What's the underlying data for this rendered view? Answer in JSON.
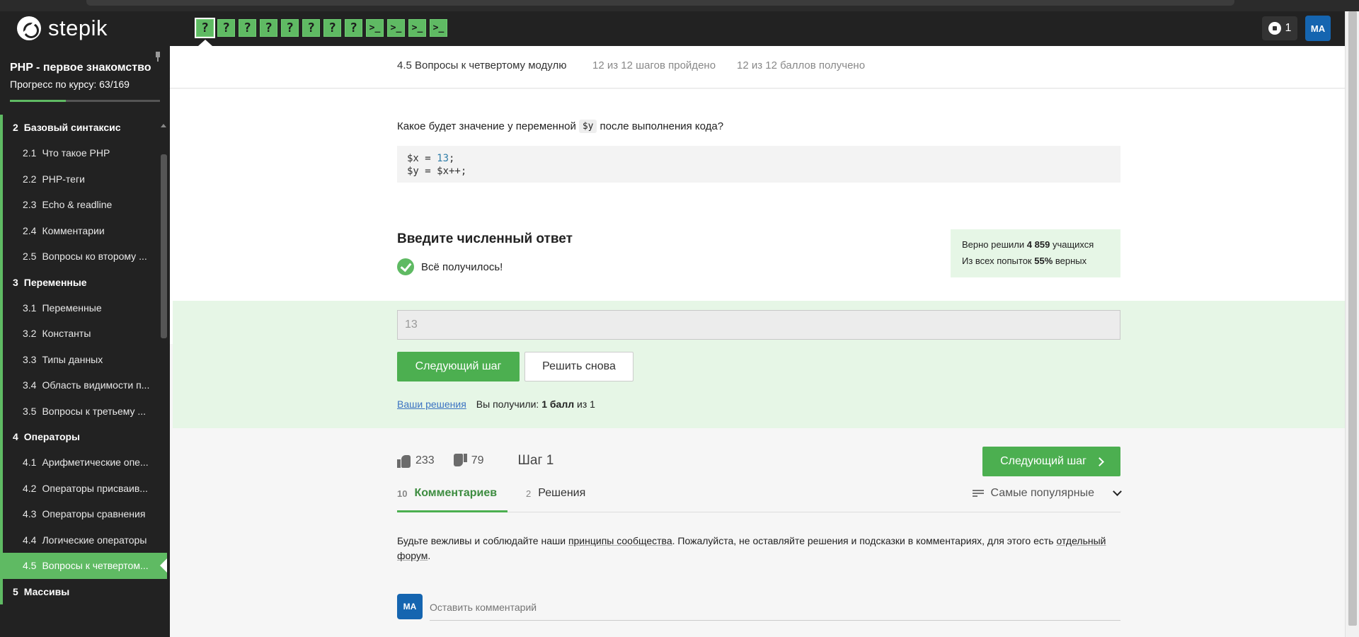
{
  "app": {
    "logo_text": "stepik"
  },
  "topbar": {
    "steps": [
      {
        "label": "?",
        "type": "quiz",
        "active": true
      },
      {
        "label": "?",
        "type": "quiz"
      },
      {
        "label": "?",
        "type": "quiz"
      },
      {
        "label": "?",
        "type": "quiz"
      },
      {
        "label": "?",
        "type": "quiz"
      },
      {
        "label": "?",
        "type": "quiz"
      },
      {
        "label": "?",
        "type": "quiz"
      },
      {
        "label": "?",
        "type": "quiz"
      },
      {
        "label": ">_",
        "type": "code"
      },
      {
        "label": ">_",
        "type": "code"
      },
      {
        "label": ">_",
        "type": "code"
      },
      {
        "label": ">_",
        "type": "code"
      }
    ],
    "notifications_count": "1",
    "avatar_initials": "MA"
  },
  "sidebar": {
    "course_title": "PHP - первое знакомство",
    "progress_label": "Прогресс по курсу:  63/169",
    "progress_fraction": 0.373,
    "toc": [
      {
        "kind": "section",
        "num": "2",
        "title": "Базовый синтаксис"
      },
      {
        "kind": "lesson",
        "num": "2.1",
        "title": "Что такое PHP"
      },
      {
        "kind": "lesson",
        "num": "2.2",
        "title": "PHP-теги"
      },
      {
        "kind": "lesson",
        "num": "2.3",
        "title": "Echo & readline"
      },
      {
        "kind": "lesson",
        "num": "2.4",
        "title": "Комментарии"
      },
      {
        "kind": "lesson",
        "num": "2.5",
        "title": "Вопросы ко второму ..."
      },
      {
        "kind": "section",
        "num": "3",
        "title": "Переменные"
      },
      {
        "kind": "lesson",
        "num": "3.1",
        "title": "Переменные"
      },
      {
        "kind": "lesson",
        "num": "3.2",
        "title": "Константы"
      },
      {
        "kind": "lesson",
        "num": "3.3",
        "title": "Типы данных"
      },
      {
        "kind": "lesson",
        "num": "3.4",
        "title": "Область видимости п..."
      },
      {
        "kind": "lesson",
        "num": "3.5",
        "title": "Вопросы к третьему ..."
      },
      {
        "kind": "section",
        "num": "4",
        "title": "Операторы"
      },
      {
        "kind": "lesson",
        "num": "4.1",
        "title": "Арифметические опе..."
      },
      {
        "kind": "lesson",
        "num": "4.2",
        "title": "Операторы присваив..."
      },
      {
        "kind": "lesson",
        "num": "4.3",
        "title": "Операторы сравнения"
      },
      {
        "kind": "lesson",
        "num": "4.4",
        "title": "Логические операторы"
      },
      {
        "kind": "lesson",
        "num": "4.5",
        "title": "Вопросы к четвертом...",
        "current": true
      },
      {
        "kind": "section",
        "num": "5",
        "title": "Массивы"
      }
    ]
  },
  "lesson_header": {
    "title": "4.5 Вопросы к четвертому модулю",
    "steps_passed": "12 из 12 шагов пройдено",
    "points": "12 из 12 баллов  получено"
  },
  "question": {
    "text_before": "Какое будет значение у переменной",
    "var": "$y",
    "text_after": "после выполнения кода?",
    "code_line1_a": "$x = ",
    "code_line1_num": "13",
    "code_line1_b": ";",
    "code_line2": "$y = $x++;"
  },
  "answer": {
    "title": "Введите численный ответ",
    "success_text": "Всё получилось!",
    "stats_line1_a": "Верно решили",
    "stats_line1_num": "4 859",
    "stats_line1_b": "учащихся",
    "stats_line2_a": "Из всех попыток",
    "stats_line2_pct": "55%",
    "stats_line2_b": "верных",
    "input_value": "13",
    "next_button": "Следующий шаг",
    "retry_button": "Решить снова",
    "your_solutions_link": "Ваши решения",
    "score_a": "Вы получили:",
    "score_bold": "1 балл",
    "score_b": "из 1"
  },
  "footer": {
    "likes": "233",
    "dislikes": "79",
    "step_label": "Шаг 1",
    "next_button": "Следующий шаг",
    "tabs": {
      "comments_count": "10",
      "comments_label": "Комментариев",
      "solutions_count": "2",
      "solutions_label": "Решения"
    },
    "sort_label": "Самые популярные",
    "rules_a": "Будьте вежливы и соблюдайте наши ",
    "rules_link1": "принципы сообщества",
    "rules_b": ". Пожалуйста, не оставляйте решения и подсказки в комментариях, для этого есть ",
    "rules_link2": "отдельный форум",
    "rules_c": ".",
    "comment_avatar": "MA",
    "comment_placeholder": "Оставить комментарий"
  }
}
